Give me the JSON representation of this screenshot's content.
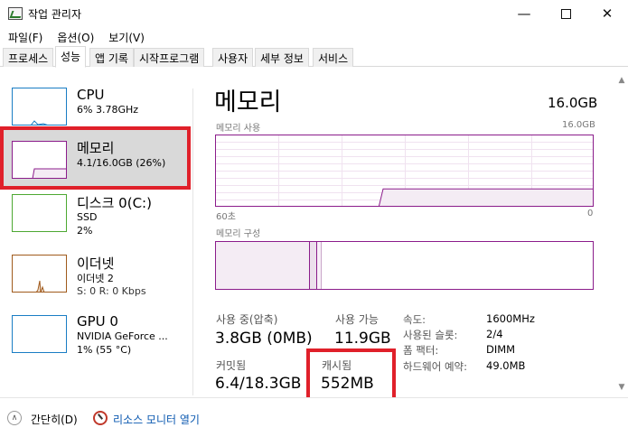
{
  "window": {
    "title": "작업 관리자",
    "minimize_glyph": "—",
    "close_glyph": "✕"
  },
  "menu": [
    "파일(F)",
    "옵션(O)",
    "보기(V)"
  ],
  "tabs": [
    "프로세스",
    "성능",
    "앱 기록",
    "시작프로그램",
    "사용자",
    "세부 정보",
    "서비스"
  ],
  "active_tab": "성능",
  "sidebar": {
    "items": [
      {
        "title": "CPU",
        "sub1": "6% 3.78GHz",
        "sub2": "",
        "color": "#1a7dc4",
        "selected": false
      },
      {
        "title": "메모리",
        "sub1": "4.1/16.0GB (26%)",
        "sub2": "",
        "color": "#8b1c8b",
        "selected": true
      },
      {
        "title": "디스크 0(C:)",
        "sub1": "SSD",
        "sub2": "2%",
        "color": "#4da832",
        "selected": false
      },
      {
        "title": "이더넷",
        "sub1": "이더넷 2",
        "sub2": "S: 0  R: 0 Kbps",
        "color": "#a05a1c",
        "selected": false
      },
      {
        "title": "GPU 0",
        "sub1": "NVIDIA GeForce ...",
        "sub2": "1% (55 °C)",
        "color": "#1a7dc4",
        "selected": false
      }
    ]
  },
  "memory": {
    "title": "메모리",
    "total": "16.0GB",
    "usage_label": "메모리 사용",
    "usage_max": "16.0GB",
    "axis_left": "60초",
    "axis_right": "0",
    "composition_label": "메모리 구성",
    "usage_fraction": 0.26,
    "graph_color": "#8b1c8b",
    "fill_color": "#f4ecf4"
  },
  "stats": {
    "in_use_label": "사용 중(압축)",
    "in_use_value": "3.8GB (0MB)",
    "available_label": "사용 가능",
    "available_value": "11.9GB",
    "committed_label": "커밋됨",
    "committed_value": "6.4/18.3GB",
    "cached_label": "캐시됨",
    "cached_value": "552MB"
  },
  "details": [
    {
      "label": "속도:",
      "value": "1600MHz"
    },
    {
      "label": "사용된 슬롯:",
      "value": "2/4"
    },
    {
      "label": "폼 팩터:",
      "value": "DIMM"
    },
    {
      "label": "하드웨어 예약:",
      "value": "49.0MB"
    }
  ],
  "footer": {
    "fewer_details": "간단히(D)",
    "resource_monitor": "리소스 모니터 열기"
  },
  "highlight_color": "#e0202a"
}
